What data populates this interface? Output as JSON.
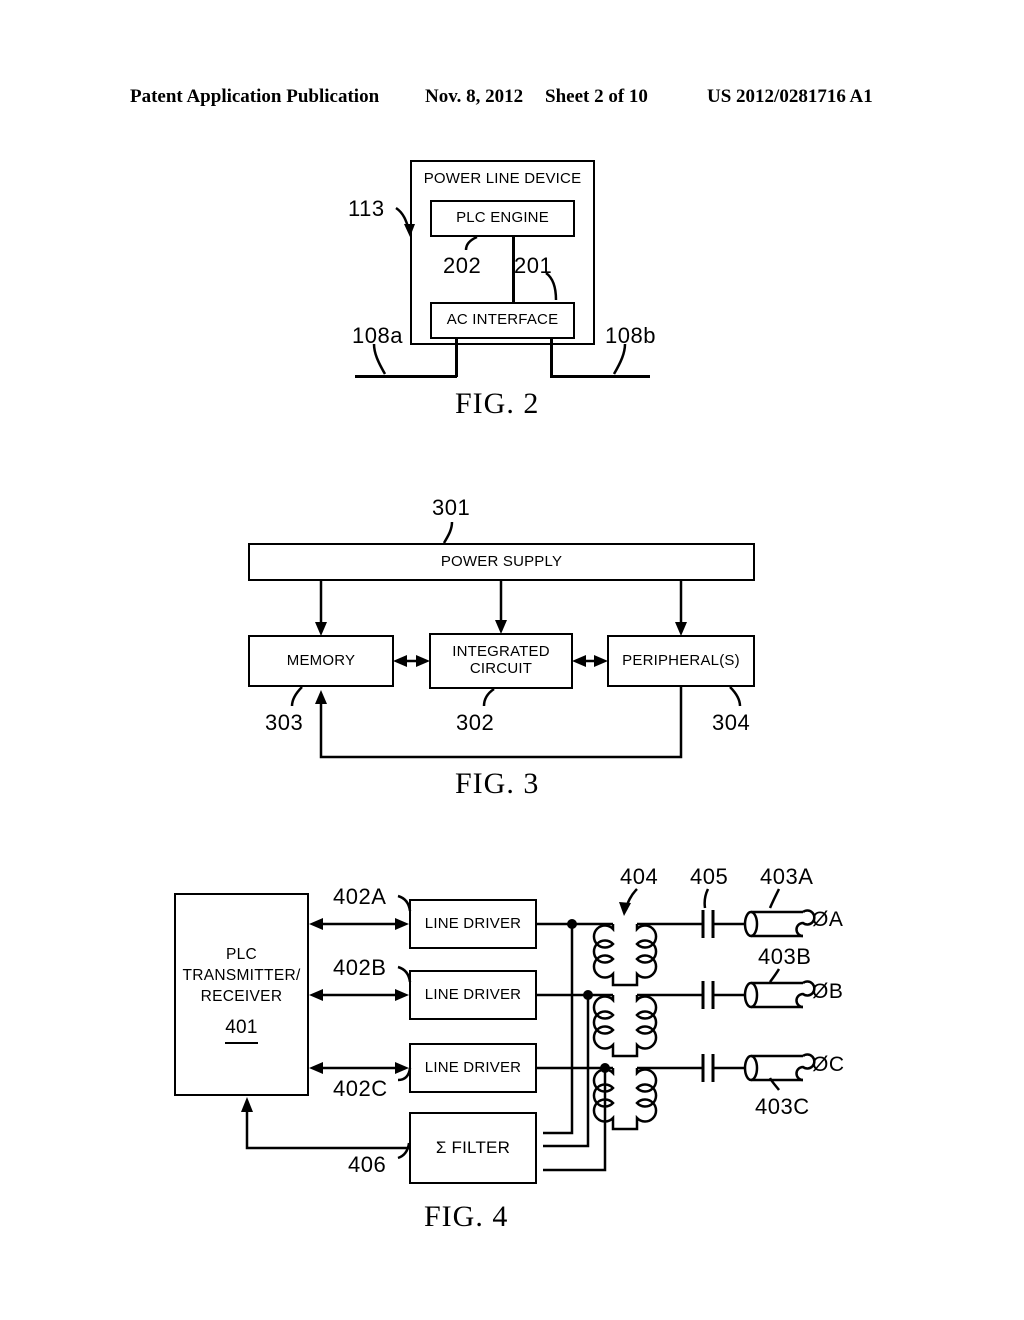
{
  "header": {
    "publication": "Patent Application Publication",
    "date": "Nov. 8, 2012",
    "sheet": "Sheet 2 of 10",
    "patent_number": "US 2012/0281716 A1"
  },
  "figures": [
    {
      "caption": "FIG. 2",
      "title": "Power Line Device block diagram",
      "blocks": {
        "outer": "POWER LINE DEVICE",
        "plc_engine": "PLC ENGINE",
        "ac_interface": "AC INTERFACE"
      },
      "reference_numerals": {
        "device": "113",
        "ac_interface_lead": "202",
        "plc_engine_lead": "201",
        "line_left": "108a",
        "line_right": "108b"
      }
    },
    {
      "caption": "FIG. 3",
      "title": "Integrated circuit subsystem block diagram",
      "blocks": {
        "power_supply": "POWER SUPPLY",
        "memory": "MEMORY",
        "integrated_circuit": "INTEGRATED\nCIRCUIT",
        "integrated_circuit_line1": "INTEGRATED",
        "integrated_circuit_line2": "CIRCUIT",
        "peripherals": "PERIPHERAL(S)"
      },
      "reference_numerals": {
        "power_supply": "301",
        "integrated_circuit": "302",
        "memory": "303",
        "peripherals": "304"
      }
    },
    {
      "caption": "FIG. 4",
      "title": "Three phase PLC transmitter/receiver coupling diagram",
      "blocks": {
        "plc_line1": "PLC",
        "plc_line2": "TRANSMITTER/",
        "plc_line3": "RECEIVER",
        "plc_numeral": "401",
        "line_driver_a": "LINE DRIVER",
        "line_driver_b": "LINE DRIVER",
        "line_driver_c": "LINE DRIVER",
        "sigma_filter": "Σ FILTER"
      },
      "reference_numerals": {
        "line_driver_a": "402A",
        "line_driver_b": "402B",
        "line_driver_c": "402C",
        "transformer": "404",
        "capacitor": "405",
        "cable_a": "403A",
        "cable_b": "403B",
        "cable_c": "403C",
        "sigma_filter": "406"
      },
      "phase_labels": {
        "phase_a": "ØA",
        "phase_b": "ØB",
        "phase_c": "ØC"
      }
    }
  ]
}
